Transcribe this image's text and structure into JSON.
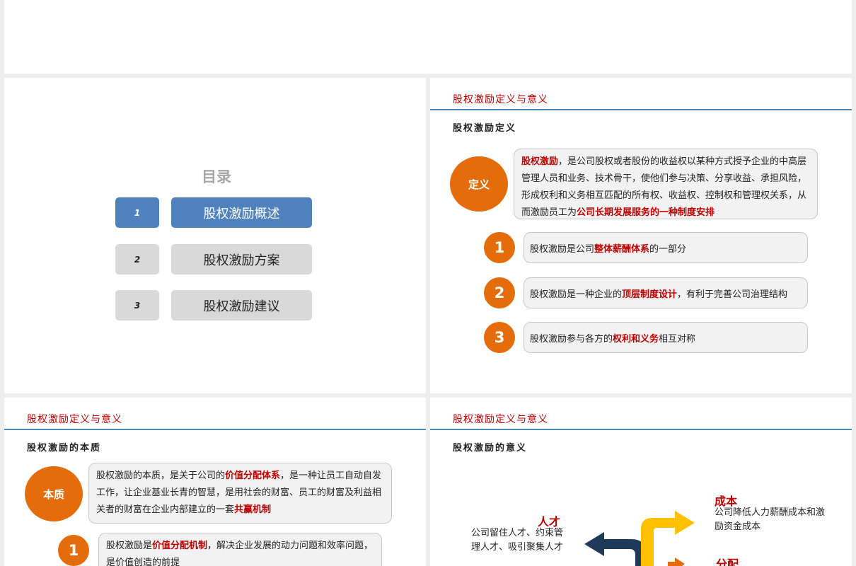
{
  "toc": {
    "title": "目录",
    "items": [
      {
        "num": "1",
        "label": "股权激励概述"
      },
      {
        "num": "2",
        "label": "股权激励方案"
      },
      {
        "num": "3",
        "label": "股权激励建议"
      }
    ]
  },
  "definition_slide": {
    "header": "股权激励定义与意义",
    "subtitle": "股权激励定义",
    "circle_label": "定义",
    "main_text": {
      "hl1": "股权激励",
      "part1": "，是公司股权或者股份的收益权以某种方式授予企业的中高层管理人员和业务、技术骨干，使他们参与决策、分享收益、承担风险，形成权利和义务相互匹配的所有权、收益权、控制权和管理权关系，从而激励员工为",
      "hl2": "公司长期发展服务的一种制度安排"
    },
    "points": [
      {
        "num": "1",
        "pre": "股权激励是公司",
        "hl": "整体薪酬体系",
        "post": "的一部分"
      },
      {
        "num": "2",
        "pre": "股权激励是一种企业的",
        "hl": "顶层制度设计",
        "post": "，有利于完善公司治理结构"
      },
      {
        "num": "3",
        "pre": "股权激励参与各方的",
        "hl": "权利和义务",
        "post": "相互对称"
      }
    ]
  },
  "essence_slide": {
    "header": "股权激励定义与意义",
    "subtitle": "股权激励的本质",
    "circle_label": "本质",
    "main_text": {
      "part1": "股权激励的本质，是关于公司的",
      "hl1": "价值分配体系",
      "part2": "，是一种让员工自动自发工作，让企业基业长青的智慧，是用社会的财富、员工的财富及利益相关者的财富在企业内部建立的一套",
      "hl2": "共赢机制"
    },
    "point1": {
      "num": "1",
      "pre": "股权激励是",
      "hl": "价值分配机制",
      "post": "，解决企业发展的动力问题和效率问题，是价值创造的前提"
    }
  },
  "significance_slide": {
    "header": "股权激励定义与意义",
    "subtitle": "股权激励的意义",
    "talent": {
      "title": "人才",
      "text": "公司留住人才、约束管理人才、吸引聚集人才"
    },
    "cost": {
      "title": "成本",
      "text": "公司降低人力薪酬成本和激励资金成本"
    },
    "distribution": {
      "title": "分配"
    }
  },
  "colors": {
    "accent_red": "#c00000",
    "circle_orange": "#e46c0a",
    "toc_active_blue": "#4f81bd",
    "header_line_blue": "#4a8ab8",
    "arrow_navy": "#1f3a5a",
    "arrow_yellow": "#ffc000"
  }
}
